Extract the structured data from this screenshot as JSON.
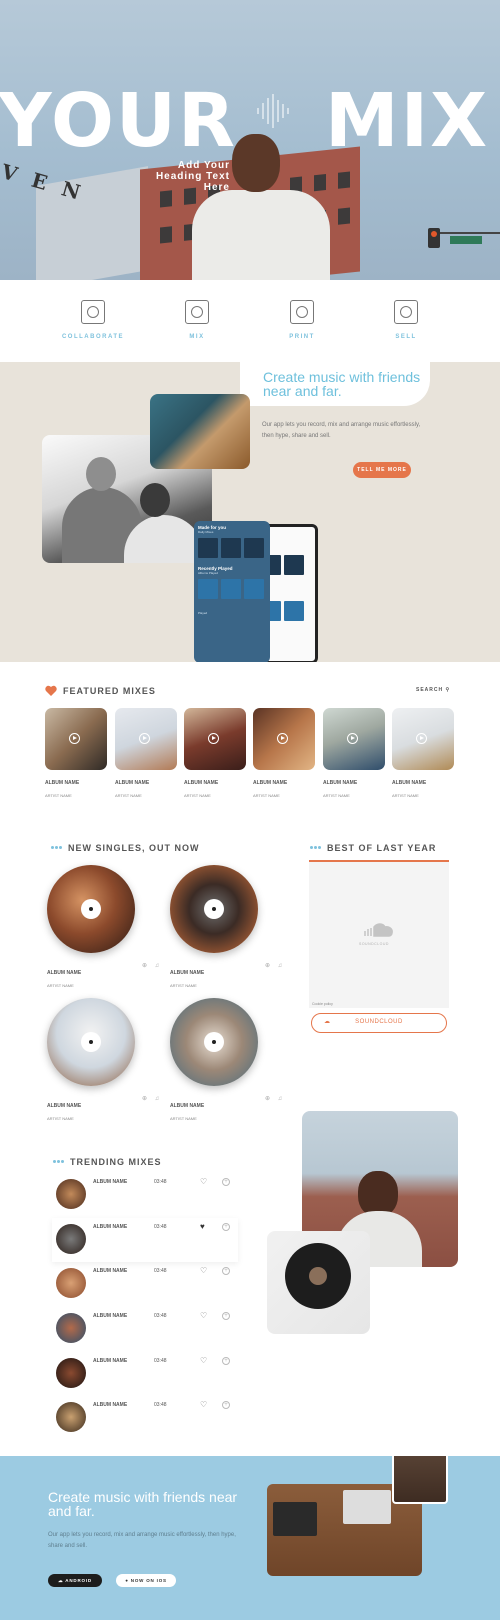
{
  "hero": {
    "title_left": "YOUR",
    "title_right": "MIX",
    "subheading_lines": [
      "Add Your",
      "Heading Text",
      "Here"
    ],
    "sign_letters": "VEN"
  },
  "features": [
    {
      "label": "COLLABORATE",
      "icon": "collaborate-icon"
    },
    {
      "label": "MIX",
      "icon": "mix-icon"
    },
    {
      "label": "PRINT",
      "icon": "print-icon"
    },
    {
      "label": "SELL",
      "icon": "sell-icon"
    }
  ],
  "create": {
    "heading": "Create music with friends near and far.",
    "text": "Our app lets you record, mix and arrange music effortlessly, then hype, share and sell.",
    "button": "TELL ME MORE",
    "phone": {
      "title": "Made for you",
      "subtitle": "Daily Mixes",
      "section2": "Recently Played",
      "section2_sub": "Albums Played",
      "label_played": "Played"
    }
  },
  "featured": {
    "title": "FEATURED MIXES",
    "search": "SEARCH",
    "cards": [
      {
        "name": "ALBUM NAME",
        "artist": "ARTIST NAME"
      },
      {
        "name": "ALBUM NAME",
        "artist": "ARTIST NAME"
      },
      {
        "name": "ALBUM NAME",
        "artist": "ARTIST NAME"
      },
      {
        "name": "ALBUM NAME",
        "artist": "ARTIST NAME"
      },
      {
        "name": "ALBUM NAME",
        "artist": "ARTIST NAME"
      },
      {
        "name": "ALBUM NAME",
        "artist": "ARTIST NAME"
      }
    ]
  },
  "singles": {
    "title": "NEW SINGLES, OUT NOW",
    "items": [
      {
        "name": "ALBUM NAME",
        "artist": "ARTIST NAME"
      },
      {
        "name": "ALBUM NAME",
        "artist": "ARTIST NAME"
      },
      {
        "name": "ALBUM NAME",
        "artist": "ARTIST NAME"
      },
      {
        "name": "ALBUM NAME",
        "artist": "ARTIST NAME"
      }
    ]
  },
  "best": {
    "title": "BEST OF LAST YEAR",
    "logo_text": "SOUNDCLOUD",
    "cookie": "Cookie policy",
    "button": "SOUNDCLOUD"
  },
  "trending": {
    "title": "TRENDING MIXES",
    "rows": [
      {
        "name": "ALBUM NAME",
        "time": "03:48",
        "liked": false
      },
      {
        "name": "ALBUM NAME",
        "time": "03:48",
        "liked": true
      },
      {
        "name": "ALBUM NAME",
        "time": "03:48",
        "liked": false
      },
      {
        "name": "ALBUM NAME",
        "time": "03:48",
        "liked": false
      },
      {
        "name": "ALBUM NAME",
        "time": "03:48",
        "liked": false
      },
      {
        "name": "ALBUM NAME",
        "time": "03:48",
        "liked": false
      }
    ]
  },
  "footer": {
    "heading": "Create music with friends near and far.",
    "text": "Our app lets you record, mix and arrange music effortlessly, then hype, share and sell.",
    "android": "ANDROID",
    "ios": "NOW ON IOS"
  },
  "colors": {
    "accent_orange": "#e5764b",
    "accent_blue": "#7fc2dd",
    "footer_bg": "#9ccbe2",
    "beige_bg": "#e8e3da"
  }
}
